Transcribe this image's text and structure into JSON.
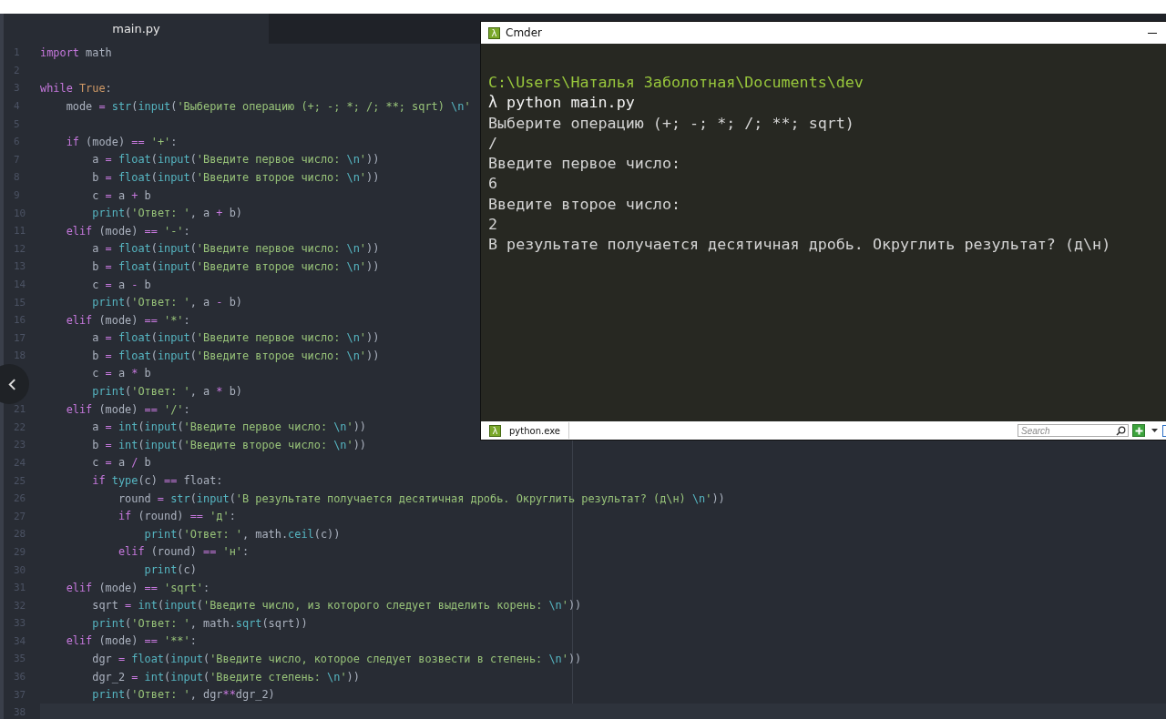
{
  "editor": {
    "tabs": [
      {
        "label": "main.py",
        "selected": true
      }
    ],
    "lines": [
      {
        "number": "1",
        "current": false,
        "tokens": [
          {
            "kind": "keyword",
            "text": "import"
          },
          {
            "kind": "plain",
            "text": " math"
          }
        ]
      },
      {
        "number": "2",
        "current": false
      },
      {
        "number": "3",
        "current": false,
        "tokens": [
          {
            "kind": "keyword",
            "text": "while"
          },
          {
            "kind": "constant",
            "text": " True"
          },
          {
            "kind": "plain",
            "text": ":"
          }
        ]
      },
      {
        "number": "4",
        "current": false,
        "tokens": [
          {
            "kind": "plain",
            "text": "    mode "
          },
          {
            "kind": "operator",
            "text": "="
          },
          {
            "kind": "builtin",
            "text": " str"
          },
          {
            "kind": "plain",
            "text": "("
          },
          {
            "kind": "builtin",
            "text": "input"
          },
          {
            "kind": "plain",
            "text": "("
          },
          {
            "kind": "string",
            "text": "'Выберите операцию (+; -; *; /; **; sqrt) "
          },
          {
            "kind": "escape",
            "text": "\\n"
          },
          {
            "kind": "string",
            "text": "'"
          }
        ]
      },
      {
        "number": "5",
        "current": false
      },
      {
        "number": "6",
        "current": false,
        "tokens": [
          {
            "kind": "keyword",
            "text": "    if"
          },
          {
            "kind": "plain",
            "text": " (mode) "
          },
          {
            "kind": "operator",
            "text": "=="
          },
          {
            "kind": "string",
            "text": " '+'"
          },
          {
            "kind": "plain",
            "text": ":"
          }
        ]
      },
      {
        "number": "7",
        "current": false,
        "tokens": [
          {
            "kind": "plain",
            "text": "        a "
          },
          {
            "kind": "operator",
            "text": "="
          },
          {
            "kind": "builtin",
            "text": " float"
          },
          {
            "kind": "plain",
            "text": "("
          },
          {
            "kind": "builtin",
            "text": "input"
          },
          {
            "kind": "plain",
            "text": "("
          },
          {
            "kind": "string",
            "text": "'Введите первое число: "
          },
          {
            "kind": "escape",
            "text": "\\n"
          },
          {
            "kind": "string",
            "text": "'"
          },
          {
            "kind": "plain",
            "text": "))"
          }
        ]
      },
      {
        "number": "8",
        "current": false,
        "tokens": [
          {
            "kind": "plain",
            "text": "        b "
          },
          {
            "kind": "operator",
            "text": "="
          },
          {
            "kind": "builtin",
            "text": " float"
          },
          {
            "kind": "plain",
            "text": "("
          },
          {
            "kind": "builtin",
            "text": "input"
          },
          {
            "kind": "plain",
            "text": "("
          },
          {
            "kind": "string",
            "text": "'Введите второе число: "
          },
          {
            "kind": "escape",
            "text": "\\n"
          },
          {
            "kind": "string",
            "text": "'"
          },
          {
            "kind": "plain",
            "text": "))"
          }
        ]
      },
      {
        "number": "9",
        "current": false,
        "tokens": [
          {
            "kind": "plain",
            "text": "        c "
          },
          {
            "kind": "operator",
            "text": "="
          },
          {
            "kind": "plain",
            "text": " a "
          },
          {
            "kind": "operator",
            "text": "+"
          },
          {
            "kind": "plain",
            "text": " b"
          }
        ]
      },
      {
        "number": "10",
        "current": false,
        "tokens": [
          {
            "kind": "builtin",
            "text": "        print"
          },
          {
            "kind": "plain",
            "text": "("
          },
          {
            "kind": "string",
            "text": "'Ответ: '"
          },
          {
            "kind": "plain",
            "text": ", a "
          },
          {
            "kind": "operator",
            "text": "+"
          },
          {
            "kind": "plain",
            "text": " b)"
          }
        ]
      },
      {
        "number": "11",
        "current": false,
        "tokens": [
          {
            "kind": "keyword",
            "text": "    elif"
          },
          {
            "kind": "plain",
            "text": " (mode) "
          },
          {
            "kind": "operator",
            "text": "=="
          },
          {
            "kind": "string",
            "text": " '-'"
          },
          {
            "kind": "plain",
            "text": ":"
          }
        ]
      },
      {
        "number": "12",
        "current": false,
        "tokens": [
          {
            "kind": "plain",
            "text": "        a "
          },
          {
            "kind": "operator",
            "text": "="
          },
          {
            "kind": "builtin",
            "text": " float"
          },
          {
            "kind": "plain",
            "text": "("
          },
          {
            "kind": "builtin",
            "text": "input"
          },
          {
            "kind": "plain",
            "text": "("
          },
          {
            "kind": "string",
            "text": "'Введите первое число: "
          },
          {
            "kind": "escape",
            "text": "\\n"
          },
          {
            "kind": "string",
            "text": "'"
          },
          {
            "kind": "plain",
            "text": "))"
          }
        ]
      },
      {
        "number": "13",
        "current": false,
        "tokens": [
          {
            "kind": "plain",
            "text": "        b "
          },
          {
            "kind": "operator",
            "text": "="
          },
          {
            "kind": "builtin",
            "text": " float"
          },
          {
            "kind": "plain",
            "text": "("
          },
          {
            "kind": "builtin",
            "text": "input"
          },
          {
            "kind": "plain",
            "text": "("
          },
          {
            "kind": "string",
            "text": "'Введите второе число: "
          },
          {
            "kind": "escape",
            "text": "\\n"
          },
          {
            "kind": "string",
            "text": "'"
          },
          {
            "kind": "plain",
            "text": "))"
          }
        ]
      },
      {
        "number": "14",
        "current": false,
        "tokens": [
          {
            "kind": "plain",
            "text": "        c "
          },
          {
            "kind": "operator",
            "text": "="
          },
          {
            "kind": "plain",
            "text": " a "
          },
          {
            "kind": "operator",
            "text": "-"
          },
          {
            "kind": "plain",
            "text": " b"
          }
        ]
      },
      {
        "number": "15",
        "current": false,
        "tokens": [
          {
            "kind": "builtin",
            "text": "        print"
          },
          {
            "kind": "plain",
            "text": "("
          },
          {
            "kind": "string",
            "text": "'Ответ: '"
          },
          {
            "kind": "plain",
            "text": ", a "
          },
          {
            "kind": "operator",
            "text": "-"
          },
          {
            "kind": "plain",
            "text": " b)"
          }
        ]
      },
      {
        "number": "16",
        "current": false,
        "tokens": [
          {
            "kind": "keyword",
            "text": "    elif"
          },
          {
            "kind": "plain",
            "text": " (mode) "
          },
          {
            "kind": "operator",
            "text": "=="
          },
          {
            "kind": "string",
            "text": " '*'"
          },
          {
            "kind": "plain",
            "text": ":"
          }
        ]
      },
      {
        "number": "17",
        "current": false,
        "tokens": [
          {
            "kind": "plain",
            "text": "        a "
          },
          {
            "kind": "operator",
            "text": "="
          },
          {
            "kind": "builtin",
            "text": " float"
          },
          {
            "kind": "plain",
            "text": "("
          },
          {
            "kind": "builtin",
            "text": "input"
          },
          {
            "kind": "plain",
            "text": "("
          },
          {
            "kind": "string",
            "text": "'Введите первое число: "
          },
          {
            "kind": "escape",
            "text": "\\n"
          },
          {
            "kind": "string",
            "text": "'"
          },
          {
            "kind": "plain",
            "text": "))"
          }
        ]
      },
      {
        "number": "18",
        "current": false,
        "tokens": [
          {
            "kind": "plain",
            "text": "        b "
          },
          {
            "kind": "operator",
            "text": "="
          },
          {
            "kind": "builtin",
            "text": " float"
          },
          {
            "kind": "plain",
            "text": "("
          },
          {
            "kind": "builtin",
            "text": "input"
          },
          {
            "kind": "plain",
            "text": "("
          },
          {
            "kind": "string",
            "text": "'Введите второе число: "
          },
          {
            "kind": "escape",
            "text": "\\n"
          },
          {
            "kind": "string",
            "text": "'"
          },
          {
            "kind": "plain",
            "text": "))"
          }
        ]
      },
      {
        "current": false,
        "tokens": [
          {
            "kind": "plain",
            "text": "        c "
          },
          {
            "kind": "operator",
            "text": "="
          },
          {
            "kind": "plain",
            "text": " a "
          },
          {
            "kind": "operator",
            "text": "*"
          },
          {
            "kind": "plain",
            "text": " b"
          }
        ]
      },
      {
        "current": false,
        "tokens": [
          {
            "kind": "builtin",
            "text": "        print"
          },
          {
            "kind": "plain",
            "text": "("
          },
          {
            "kind": "string",
            "text": "'Ответ: '"
          },
          {
            "kind": "plain",
            "text": ", a "
          },
          {
            "kind": "operator",
            "text": "*"
          },
          {
            "kind": "plain",
            "text": " b)"
          }
        ]
      },
      {
        "number": "21",
        "current": false,
        "tokens": [
          {
            "kind": "keyword",
            "text": "    elif"
          },
          {
            "kind": "plain",
            "text": " (mode) "
          },
          {
            "kind": "operator",
            "text": "=="
          },
          {
            "kind": "string",
            "text": " '/'"
          },
          {
            "kind": "plain",
            "text": ":"
          }
        ]
      },
      {
        "number": "22",
        "current": false,
        "tokens": [
          {
            "kind": "plain",
            "text": "        a "
          },
          {
            "kind": "operator",
            "text": "="
          },
          {
            "kind": "builtin",
            "text": " int"
          },
          {
            "kind": "plain",
            "text": "("
          },
          {
            "kind": "builtin",
            "text": "input"
          },
          {
            "kind": "plain",
            "text": "("
          },
          {
            "kind": "string",
            "text": "'Введите первое число: "
          },
          {
            "kind": "escape",
            "text": "\\n"
          },
          {
            "kind": "string",
            "text": "'"
          },
          {
            "kind": "plain",
            "text": "))"
          }
        ]
      },
      {
        "number": "23",
        "current": false,
        "tokens": [
          {
            "kind": "plain",
            "text": "        b "
          },
          {
            "kind": "operator",
            "text": "="
          },
          {
            "kind": "builtin",
            "text": " int"
          },
          {
            "kind": "plain",
            "text": "("
          },
          {
            "kind": "builtin",
            "text": "input"
          },
          {
            "kind": "plain",
            "text": "("
          },
          {
            "kind": "string",
            "text": "'Введите второе число: "
          },
          {
            "kind": "escape",
            "text": "\\n"
          },
          {
            "kind": "string",
            "text": "'"
          },
          {
            "kind": "plain",
            "text": "))"
          }
        ]
      },
      {
        "number": "24",
        "current": false,
        "tokens": [
          {
            "kind": "plain",
            "text": "        c "
          },
          {
            "kind": "operator",
            "text": "="
          },
          {
            "kind": "plain",
            "text": " a "
          },
          {
            "kind": "operator",
            "text": "/"
          },
          {
            "kind": "plain",
            "text": " b"
          }
        ]
      },
      {
        "number": "25",
        "current": false,
        "tokens": [
          {
            "kind": "keyword",
            "text": "        if"
          },
          {
            "kind": "builtin",
            "text": " type"
          },
          {
            "kind": "plain",
            "text": "(c) "
          },
          {
            "kind": "operator",
            "text": "=="
          },
          {
            "kind": "plain",
            "text": " float:"
          }
        ]
      },
      {
        "number": "26",
        "current": false,
        "tokens": [
          {
            "kind": "plain",
            "text": "            round "
          },
          {
            "kind": "operator",
            "text": "="
          },
          {
            "kind": "builtin",
            "text": " str"
          },
          {
            "kind": "plain",
            "text": "("
          },
          {
            "kind": "builtin",
            "text": "input"
          },
          {
            "kind": "plain",
            "text": "("
          },
          {
            "kind": "string",
            "text": "'В результате получается десятичная дробь. Округлить результат? (д\\н) "
          },
          {
            "kind": "escape",
            "text": "\\n"
          },
          {
            "kind": "string",
            "text": "'"
          },
          {
            "kind": "plain",
            "text": "))"
          }
        ]
      },
      {
        "number": "27",
        "current": false,
        "tokens": [
          {
            "kind": "keyword",
            "text": "            if"
          },
          {
            "kind": "plain",
            "text": " (round) "
          },
          {
            "kind": "operator",
            "text": "=="
          },
          {
            "kind": "string",
            "text": " 'д'"
          },
          {
            "kind": "plain",
            "text": ":"
          }
        ]
      },
      {
        "number": "28",
        "current": false,
        "tokens": [
          {
            "kind": "builtin",
            "text": "                print"
          },
          {
            "kind": "plain",
            "text": "("
          },
          {
            "kind": "string",
            "text": "'Ответ: '"
          },
          {
            "kind": "plain",
            "text": ", math."
          },
          {
            "kind": "builtin",
            "text": "ceil"
          },
          {
            "kind": "plain",
            "text": "(c))"
          }
        ]
      },
      {
        "number": "29",
        "current": false,
        "tokens": [
          {
            "kind": "keyword",
            "text": "            elif"
          },
          {
            "kind": "plain",
            "text": " (round) "
          },
          {
            "kind": "operator",
            "text": "=="
          },
          {
            "kind": "string",
            "text": " 'н'"
          },
          {
            "kind": "plain",
            "text": ":"
          }
        ]
      },
      {
        "number": "30",
        "current": false,
        "tokens": [
          {
            "kind": "builtin",
            "text": "                print"
          },
          {
            "kind": "plain",
            "text": "(c)"
          }
        ]
      },
      {
        "number": "31",
        "current": false,
        "tokens": [
          {
            "kind": "keyword",
            "text": "    elif"
          },
          {
            "kind": "plain",
            "text": " (mode) "
          },
          {
            "kind": "operator",
            "text": "=="
          },
          {
            "kind": "string",
            "text": " 'sqrt'"
          },
          {
            "kind": "plain",
            "text": ":"
          }
        ]
      },
      {
        "number": "32",
        "current": false,
        "tokens": [
          {
            "kind": "plain",
            "text": "        sqrt "
          },
          {
            "kind": "operator",
            "text": "="
          },
          {
            "kind": "builtin",
            "text": " int"
          },
          {
            "kind": "plain",
            "text": "("
          },
          {
            "kind": "builtin",
            "text": "input"
          },
          {
            "kind": "plain",
            "text": "("
          },
          {
            "kind": "string",
            "text": "'Введите число, из которого следует выделить корень: "
          },
          {
            "kind": "escape",
            "text": "\\n"
          },
          {
            "kind": "string",
            "text": "'"
          },
          {
            "kind": "plain",
            "text": "))"
          }
        ]
      },
      {
        "number": "33",
        "current": false,
        "tokens": [
          {
            "kind": "builtin",
            "text": "        print"
          },
          {
            "kind": "plain",
            "text": "("
          },
          {
            "kind": "string",
            "text": "'Ответ: '"
          },
          {
            "kind": "plain",
            "text": ", math."
          },
          {
            "kind": "builtin",
            "text": "sqrt"
          },
          {
            "kind": "plain",
            "text": "(sqrt))"
          }
        ]
      },
      {
        "number": "34",
        "current": false,
        "tokens": [
          {
            "kind": "keyword",
            "text": "    elif"
          },
          {
            "kind": "plain",
            "text": " (mode) "
          },
          {
            "kind": "operator",
            "text": "=="
          },
          {
            "kind": "string",
            "text": " '**'"
          },
          {
            "kind": "plain",
            "text": ":"
          }
        ]
      },
      {
        "number": "35",
        "current": false,
        "tokens": [
          {
            "kind": "plain",
            "text": "        dgr "
          },
          {
            "kind": "operator",
            "text": "="
          },
          {
            "kind": "builtin",
            "text": " float"
          },
          {
            "kind": "plain",
            "text": "("
          },
          {
            "kind": "builtin",
            "text": "input"
          },
          {
            "kind": "plain",
            "text": "("
          },
          {
            "kind": "string",
            "text": "'Введите число, которое следует возвести в степень: "
          },
          {
            "kind": "escape",
            "text": "\\n"
          },
          {
            "kind": "string",
            "text": "'"
          },
          {
            "kind": "plain",
            "text": "))"
          }
        ]
      },
      {
        "number": "36",
        "current": false,
        "tokens": [
          {
            "kind": "plain",
            "text": "        dgr_2 "
          },
          {
            "kind": "operator",
            "text": "="
          },
          {
            "kind": "builtin",
            "text": " int"
          },
          {
            "kind": "plain",
            "text": "("
          },
          {
            "kind": "builtin",
            "text": "input"
          },
          {
            "kind": "plain",
            "text": "("
          },
          {
            "kind": "string",
            "text": "'Введите степень: "
          },
          {
            "kind": "escape",
            "text": "\\n"
          },
          {
            "kind": "string",
            "text": "'"
          },
          {
            "kind": "plain",
            "text": "))"
          }
        ]
      },
      {
        "number": "37",
        "current": false,
        "tokens": [
          {
            "kind": "builtin",
            "text": "        print"
          },
          {
            "kind": "plain",
            "text": "("
          },
          {
            "kind": "string",
            "text": "'Ответ: '"
          },
          {
            "kind": "plain",
            "text": ", dgr"
          },
          {
            "kind": "operator",
            "text": "**"
          },
          {
            "kind": "plain",
            "text": "dgr_2)"
          }
        ]
      },
      {
        "number": "38",
        "current": true
      }
    ]
  },
  "terminal": {
    "window": {
      "title": "Cmder",
      "icon": "λ"
    },
    "lines": [
      {
        "kind": "path",
        "text": "C:\\Users\\Наталья Заболотная\\Documents\\dev"
      },
      {
        "kind": "command",
        "text": "λ python main.py"
      },
      {
        "kind": "output",
        "text": "Выберите операцию (+; -; *; /; **; sqrt)"
      },
      {
        "kind": "output",
        "text": "/"
      },
      {
        "kind": "output",
        "text": "Введите первое число:"
      },
      {
        "kind": "output",
        "text": "6"
      },
      {
        "kind": "output",
        "text": "Введите второе число:"
      },
      {
        "kind": "output",
        "text": "2"
      },
      {
        "kind": "output",
        "text": "В результате получается десятичная дробь. Округлить результат? (д\\н)"
      }
    ],
    "tabs": [
      {
        "label": "python.exe",
        "icon": "λ"
      }
    ],
    "search": {
      "placeholder": "Search"
    }
  }
}
